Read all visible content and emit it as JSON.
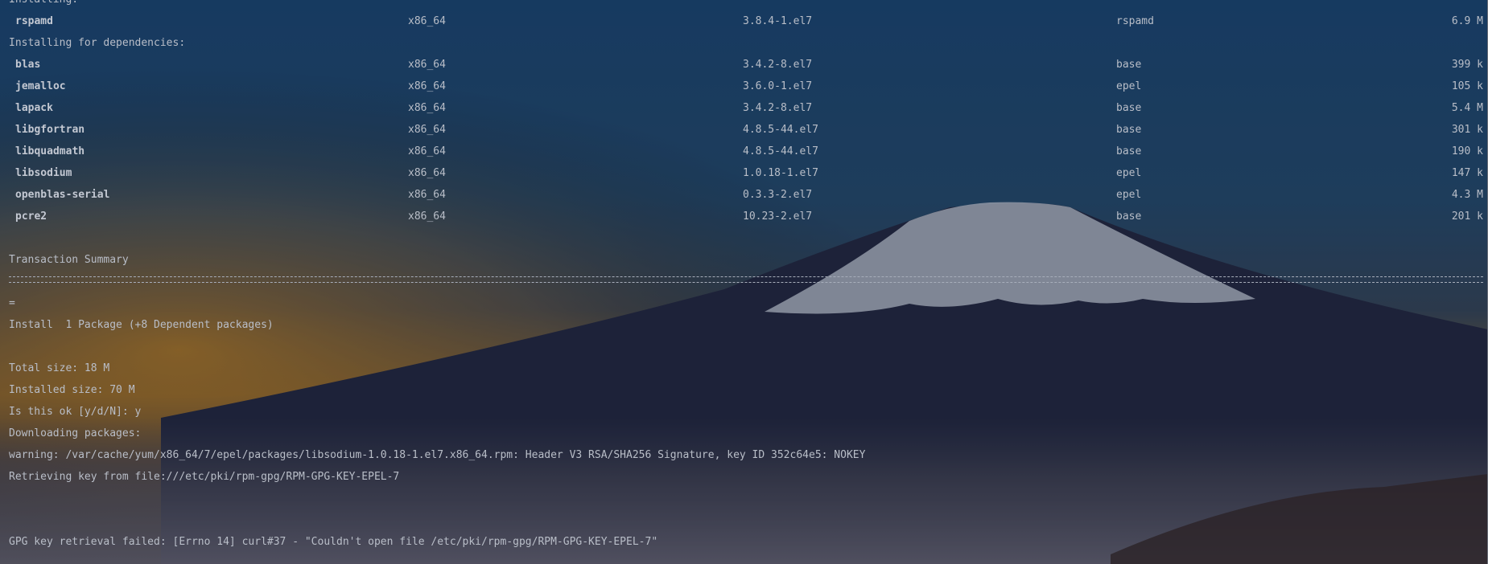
{
  "colors": {
    "text": "#b9bec8",
    "sky_top": "#1f4d7a",
    "horizon_glow": "#c98a2a",
    "mountain": "#262a44"
  },
  "terminal": {
    "top_partial": "Installing:",
    "installing": {
      "name": "rspamd",
      "arch": "x86_64",
      "version": "3.8.4-1.el7",
      "repo": "rspamd",
      "size": "6.9 M"
    },
    "deps_header": "Installing for dependencies:",
    "dependencies": [
      {
        "name": "blas",
        "arch": "x86_64",
        "version": "3.4.2-8.el7",
        "repo": "base",
        "size": "399 k"
      },
      {
        "name": "jemalloc",
        "arch": "x86_64",
        "version": "3.6.0-1.el7",
        "repo": "epel",
        "size": "105 k"
      },
      {
        "name": "lapack",
        "arch": "x86_64",
        "version": "3.4.2-8.el7",
        "repo": "base",
        "size": "5.4 M"
      },
      {
        "name": "libgfortran",
        "arch": "x86_64",
        "version": "4.8.5-44.el7",
        "repo": "base",
        "size": "301 k"
      },
      {
        "name": "libquadmath",
        "arch": "x86_64",
        "version": "4.8.5-44.el7",
        "repo": "base",
        "size": "190 k"
      },
      {
        "name": "libsodium",
        "arch": "x86_64",
        "version": "1.0.18-1.el7",
        "repo": "epel",
        "size": "147 k"
      },
      {
        "name": "openblas-serial",
        "arch": "x86_64",
        "version": "0.3.3-2.el7",
        "repo": "epel",
        "size": "4.3 M"
      },
      {
        "name": "pcre2",
        "arch": "x86_64",
        "version": "10.23-2.el7",
        "repo": "base",
        "size": "201 k"
      }
    ],
    "summary_title": "Transaction Summary",
    "summary_sep_tail": "=",
    "install_line": "Install  1 Package (+8 Dependent packages)",
    "total_size": "Total size: 18 M",
    "installed_size": "Installed size: 70 M",
    "prompt": "Is this ok [y/d/N]: y",
    "downloading": "Downloading packages:",
    "warning": "warning: /var/cache/yum/x86_64/7/epel/packages/libsodium-1.0.18-1.el7.x86_64.rpm: Header V3 RSA/SHA256 Signature, key ID 352c64e5: NOKEY",
    "retrieving": "Retrieving key from file:///etc/pki/rpm-gpg/RPM-GPG-KEY-EPEL-7",
    "gpg_failed": "GPG key retrieval failed: [Errno 14] curl#37 - \"Couldn't open file /etc/pki/rpm-gpg/RPM-GPG-KEY-EPEL-7\""
  }
}
